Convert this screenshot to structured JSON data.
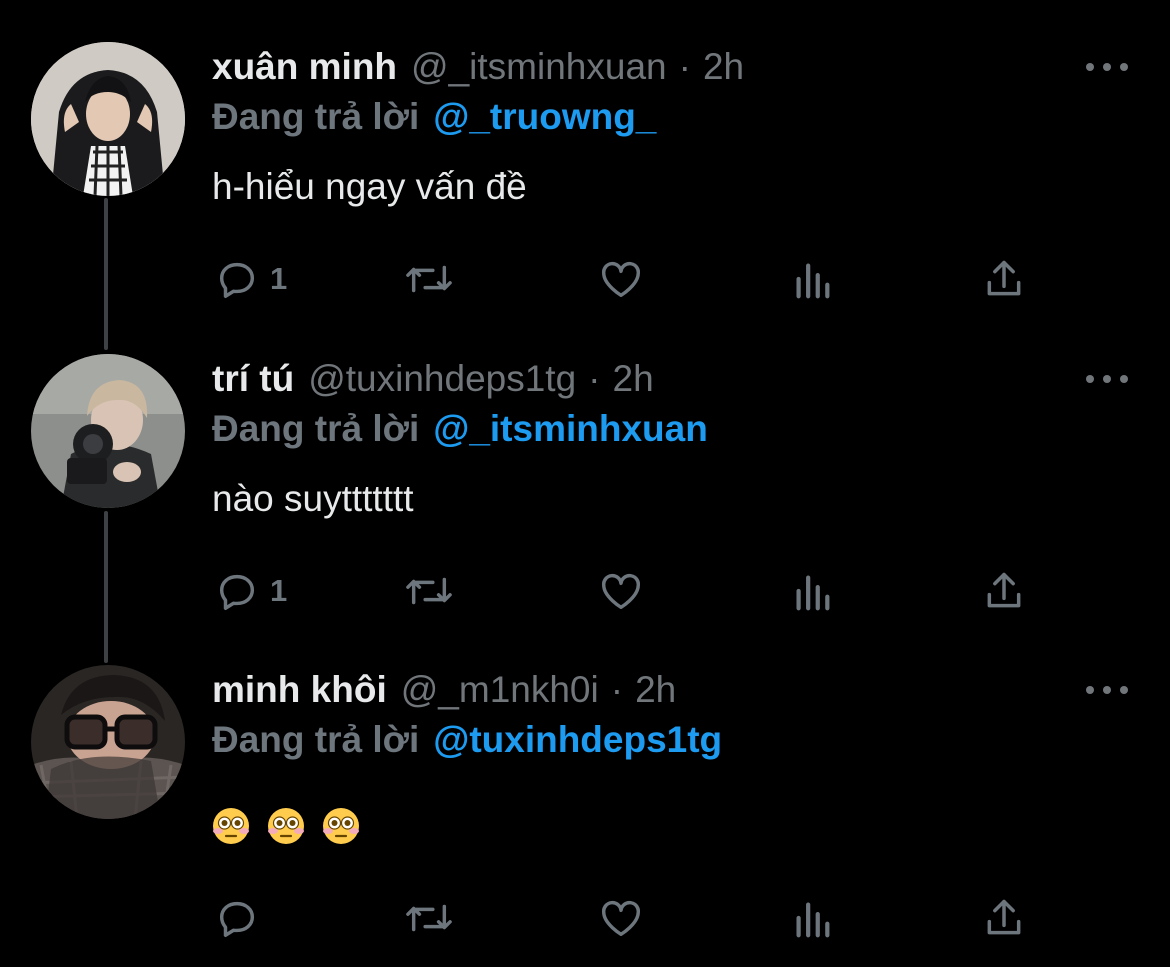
{
  "reply_prefix": "Đang trả lời",
  "tweets": [
    {
      "display_name": "xuân minh",
      "handle": "@_itsminhxuan",
      "separator": "·",
      "time": "2h",
      "replying_to": "@_truowng_",
      "text": "h-hiểu ngay vấn đề",
      "reply_count": "1",
      "avatar_icon": "profile-photo-hooded-person"
    },
    {
      "display_name": "trí tú",
      "handle": "@tuxinhdeps1tg",
      "separator": "·",
      "time": "2h",
      "replying_to": "@_itsminhxuan",
      "text": "nào suyttttttt",
      "reply_count": "1",
      "avatar_icon": "profile-photo-person-with-camera"
    },
    {
      "display_name": "minh khôi",
      "handle": "@_m1nkh0i",
      "separator": "·",
      "time": "2h",
      "replying_to": "@tuxinhdeps1tg",
      "emojis": [
        "flushed-face-emoji",
        "flushed-face-emoji",
        "flushed-face-emoji"
      ],
      "reply_count": "",
      "avatar_icon": "profile-photo-person-with-glasses"
    }
  ],
  "icons": {
    "reply": "reply-bubble-icon",
    "retweet": "retweet-icon",
    "like": "heart-icon",
    "analytics": "analytics-icon",
    "share": "share-icon",
    "more": "more-dots-icon"
  },
  "colors": {
    "background": "#000000",
    "primary_text": "#e7e9ea",
    "secondary_text": "#71767b",
    "link": "#1d9bf0",
    "thread_line": "#3e4144"
  }
}
